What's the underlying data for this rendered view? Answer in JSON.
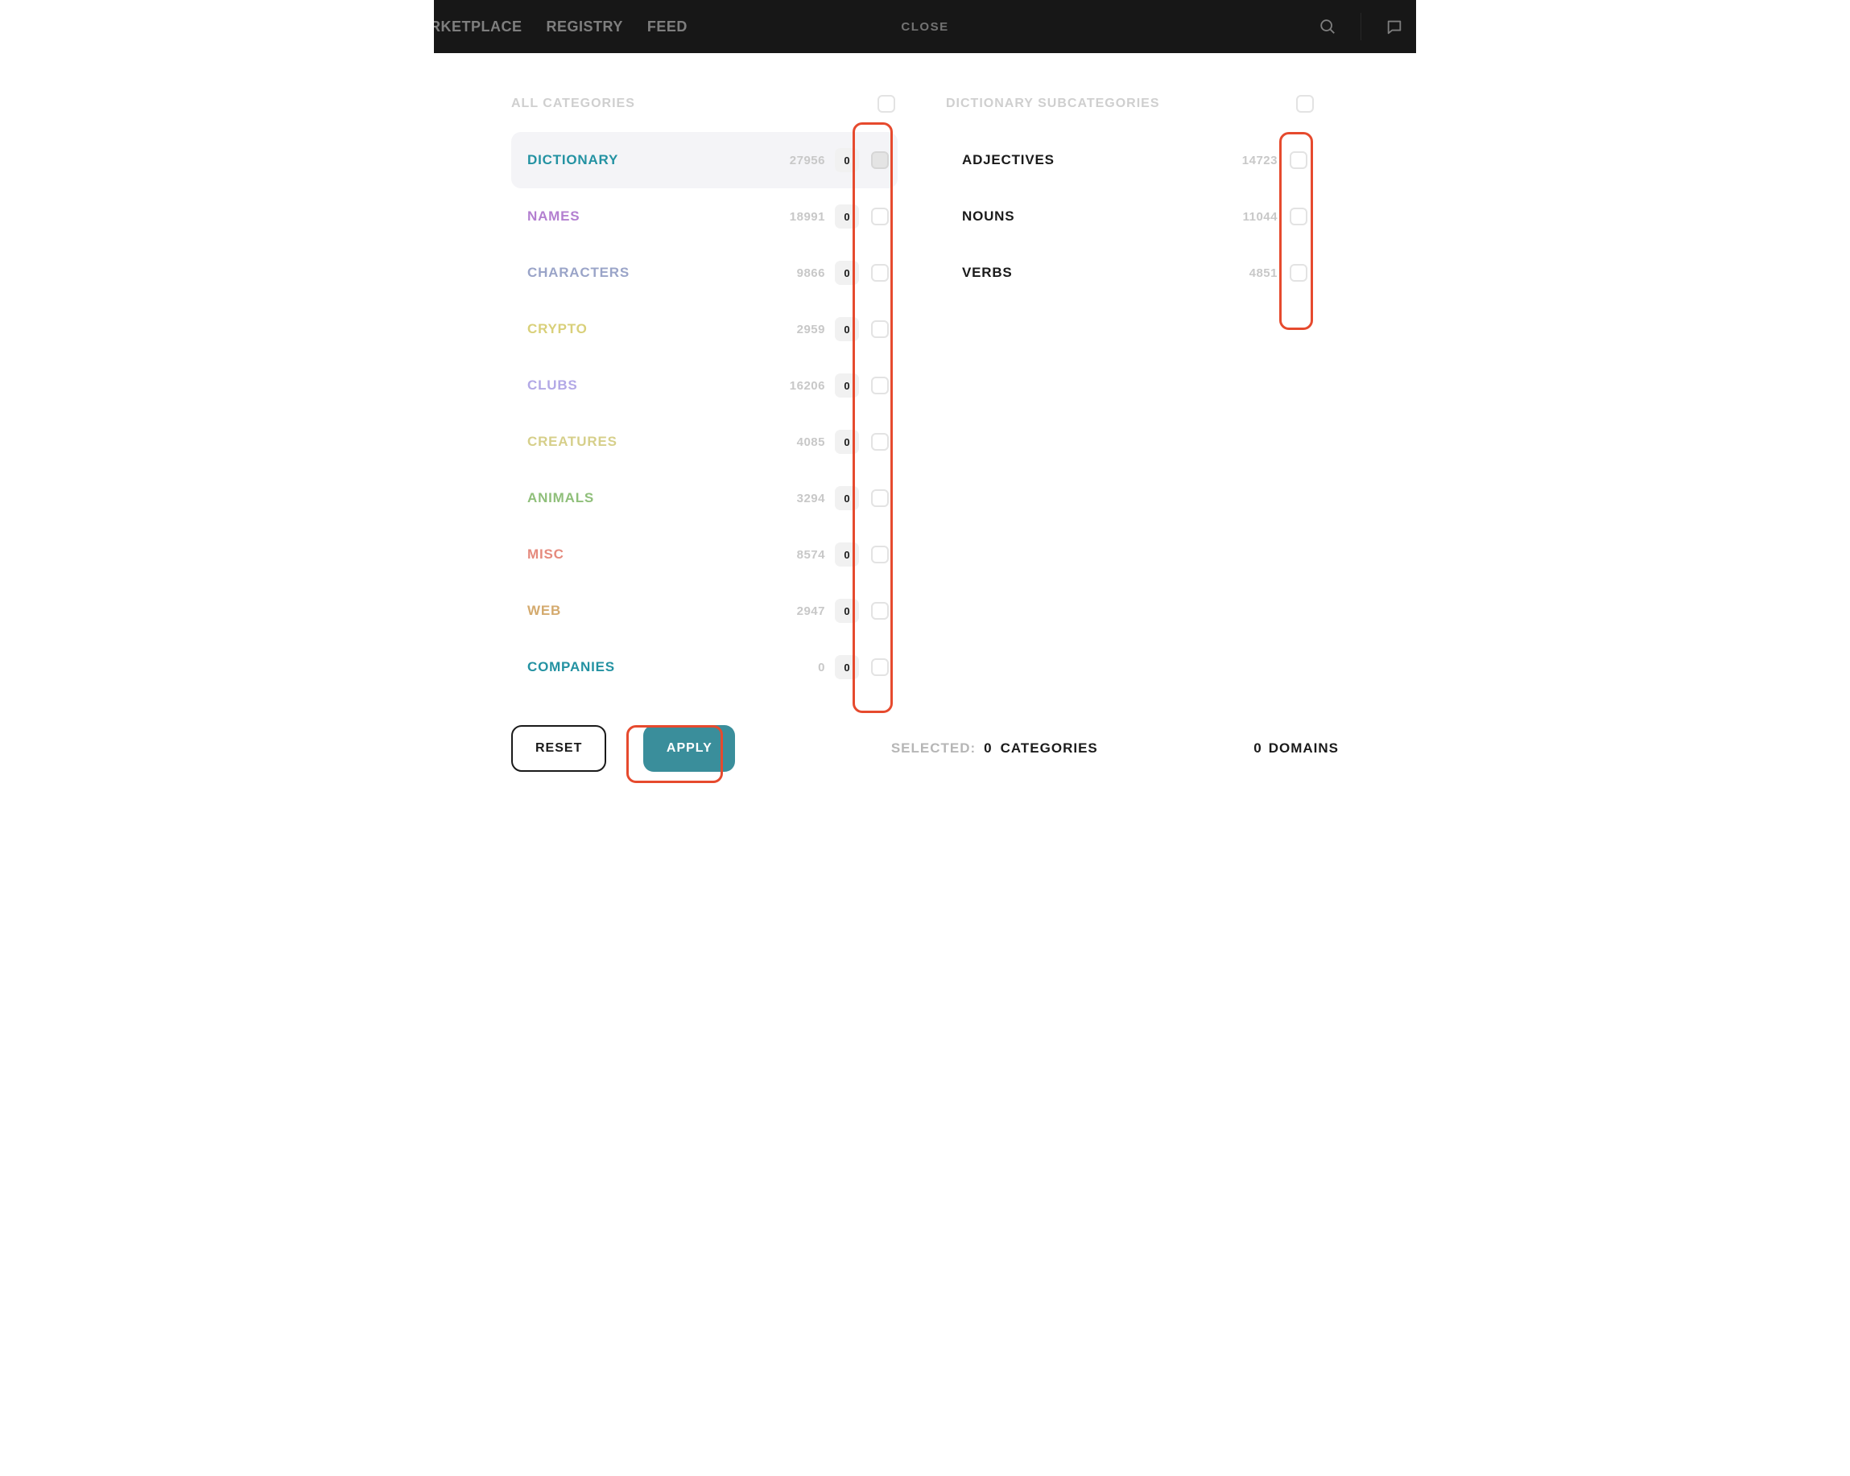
{
  "nav": {
    "items": [
      "MARKETPLACE",
      "REGISTRY",
      "FEED"
    ]
  },
  "modal": {
    "close_label": "CLOSE",
    "categories_header": "ALL CATEGORIES",
    "subcategories_header": "DICTIONARY SUBCATEGORIES",
    "categories": [
      {
        "label": "DICTIONARY",
        "count": "27956",
        "badge": "0",
        "cls": "c-dictionary",
        "selected": true
      },
      {
        "label": "NAMES",
        "count": "18991",
        "badge": "0",
        "cls": "c-names"
      },
      {
        "label": "CHARACTERS",
        "count": "9866",
        "badge": "0",
        "cls": "c-characters"
      },
      {
        "label": "CRYPTO",
        "count": "2959",
        "badge": "0",
        "cls": "c-crypto"
      },
      {
        "label": "CLUBS",
        "count": "16206",
        "badge": "0",
        "cls": "c-clubs"
      },
      {
        "label": "CREATURES",
        "count": "4085",
        "badge": "0",
        "cls": "c-creatures"
      },
      {
        "label": "ANIMALS",
        "count": "3294",
        "badge": "0",
        "cls": "c-animals"
      },
      {
        "label": "MISC",
        "count": "8574",
        "badge": "0",
        "cls": "c-misc"
      },
      {
        "label": "WEB",
        "count": "2947",
        "badge": "0",
        "cls": "c-web"
      },
      {
        "label": "COMPANIES",
        "count": "0",
        "badge": "0",
        "cls": "c-companies"
      }
    ],
    "subcategories": [
      {
        "label": "ADJECTIVES",
        "count": "14723"
      },
      {
        "label": "NOUNS",
        "count": "11044"
      },
      {
        "label": "VERBS",
        "count": "4851"
      }
    ],
    "reset_label": "RESET",
    "apply_label": "APPLY",
    "selected_label": "SELECTED:",
    "selected_count": "0",
    "selected_suffix": "CATEGORIES",
    "domains_count": "0",
    "domains_suffix": "DOMAINS"
  }
}
